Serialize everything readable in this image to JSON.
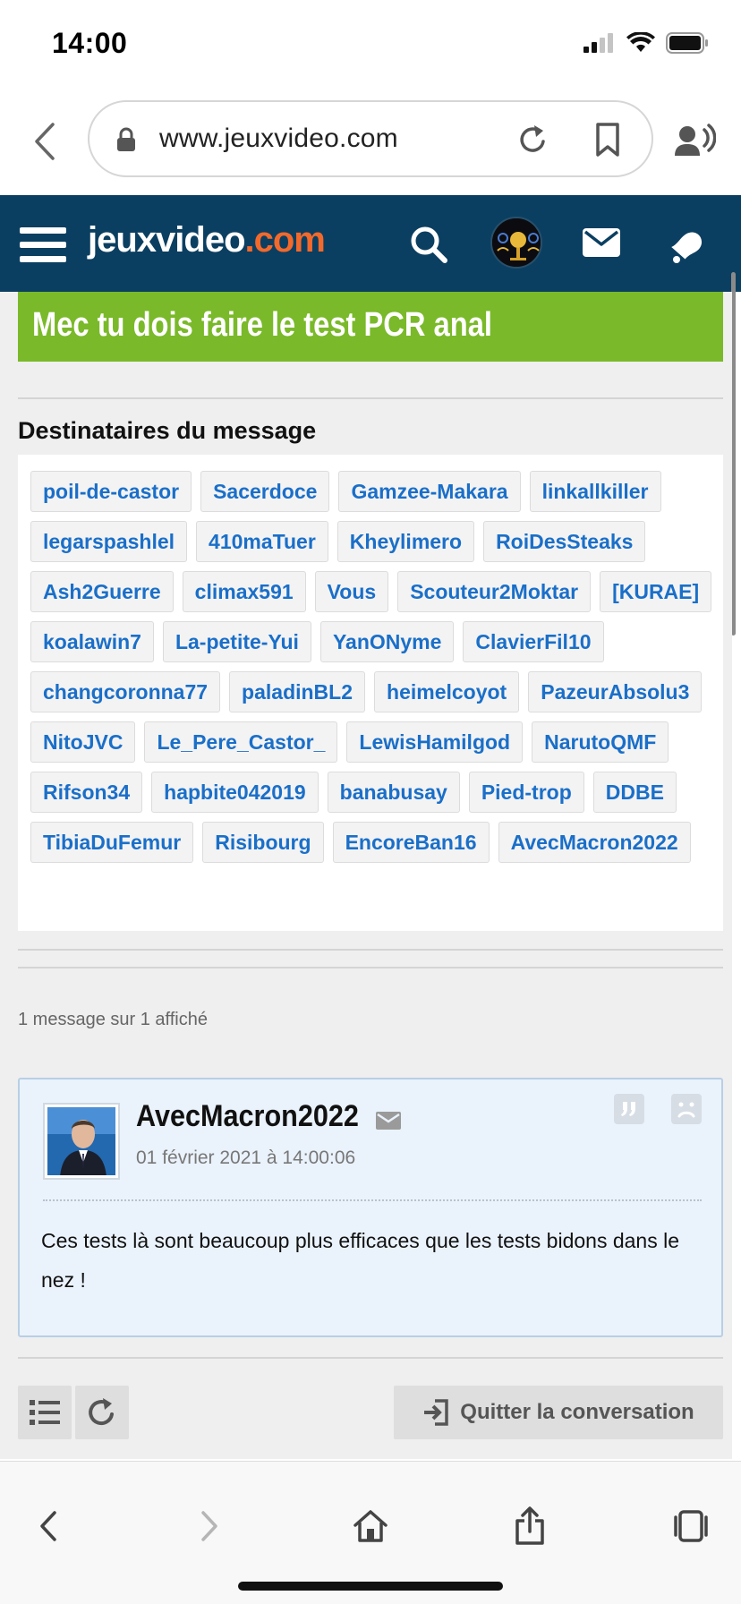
{
  "status_bar": {
    "time": "14:00"
  },
  "browser": {
    "url": "www.jeuxvideo.com",
    "icons": [
      "back-icon",
      "lock-icon",
      "reload-icon",
      "bookmark-icon",
      "speaker-icon"
    ]
  },
  "site_header": {
    "logo_part1": "jeuxvideo",
    "logo_part2": ".com",
    "brand_colors": {
      "header_bg": "#0b3f61",
      "logo_accent": "#f2692c"
    },
    "icons": [
      "menu-icon",
      "search-icon",
      "user-avatar",
      "mail-icon",
      "bell-icon"
    ]
  },
  "topic": {
    "title": "Mec tu dois faire le test PCR anal",
    "title_bg": "#7ab929"
  },
  "recipients": {
    "heading": "Destinataires du message",
    "items": [
      "poil-de-castor",
      "Sacerdoce",
      "Gamzee-Makara",
      "linkallkiller",
      "legarspashlel",
      "410maTuer",
      "Kheylimero",
      "RoiDesSteaks",
      "Ash2Guerre",
      "climax591",
      "Vous",
      "Scouteur2Moktar",
      "[KURAE]",
      "koalawin7",
      "La-petite-Yui",
      "YanONyme",
      "ClavierFil10",
      "changcoronna77",
      "paladinBL2",
      "heimelcoyot",
      "PazeurAbsolu3",
      "NitoJVC",
      "Le_Pere_Castor_",
      "LewisHamilgod",
      "NarutoQMF",
      "Rifson34",
      "hapbite042019",
      "banabusay",
      "Pied-trop",
      "DDBE",
      "TibiaDuFemur",
      "Risibourg",
      "EncoreBan16",
      "AvecMacron2022"
    ]
  },
  "message_count": "1 message sur 1 affiché",
  "message": {
    "author": "AvecMacron2022",
    "date": "01 février 2021 à 14:00:06",
    "body": "Ces tests là sont beaucoup plus efficaces que les tests bidons dans le nez !"
  },
  "actions": {
    "leave_label": "Quitter la conversation"
  }
}
